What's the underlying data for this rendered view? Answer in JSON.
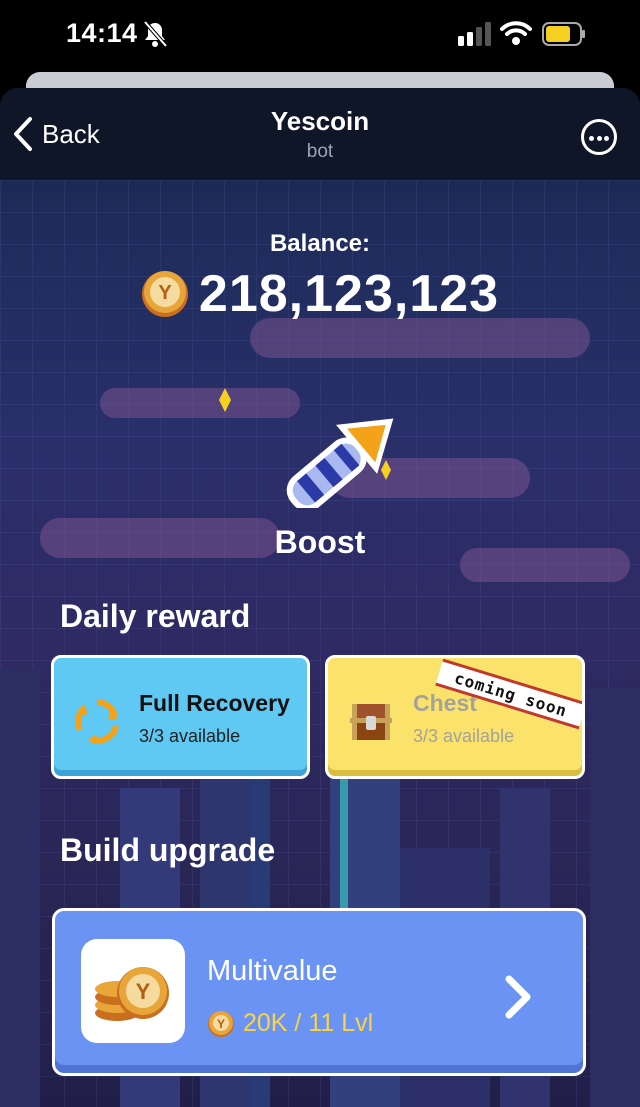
{
  "status_bar": {
    "time": "14:14"
  },
  "nav": {
    "back_label": "Back",
    "title": "Yescoin",
    "subtitle": "bot"
  },
  "balance": {
    "label": "Balance:",
    "value": "218,123,123"
  },
  "boost": {
    "label": "Boost"
  },
  "daily_reward": {
    "title": "Daily reward",
    "cards": [
      {
        "title": "Full Recovery",
        "subtitle": "3/3 available"
      },
      {
        "title": "Chest",
        "subtitle": "3/3 available",
        "badge": "coming soon"
      }
    ]
  },
  "build_upgrade": {
    "title": "Build upgrade",
    "item": {
      "name": "Multivalue",
      "cost": "20K / 11 Lvl"
    }
  },
  "colors": {
    "coin": "#e8a53a",
    "recovery_card": "#5fc8f3",
    "chest_card": "#fbe36b",
    "upgrade_card": "#6a93f3",
    "cost_text": "#f7d44a"
  }
}
